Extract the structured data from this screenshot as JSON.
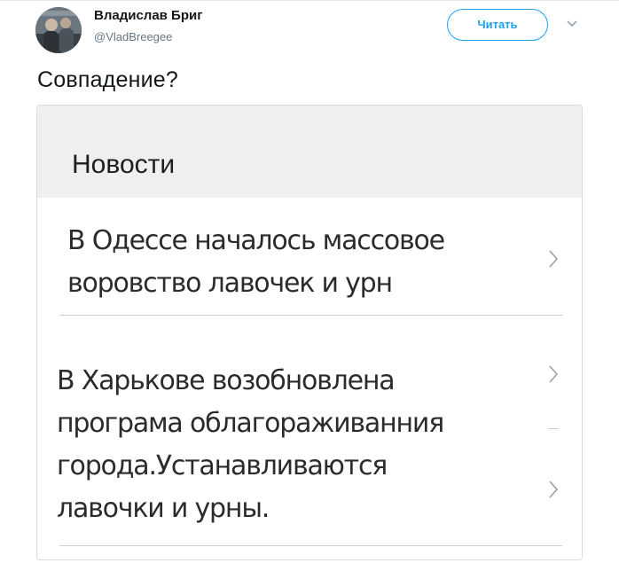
{
  "author": {
    "name": "Владислав Бриг",
    "handle": "@VladBreegee"
  },
  "follow_button": {
    "label": "Читать"
  },
  "tweet": {
    "text": "Совпадение?"
  },
  "screenshot": {
    "section_title": "Новости",
    "items": [
      {
        "lines": [
          "В Одессе началось массовое",
          "воровство лавочек и урн"
        ],
        "icon": "chevron-right-icon"
      },
      {
        "lines": [
          "В Харькове возобновлена",
          "програма облагораживанния",
          "города.Устанавливаются",
          "лавочки и урны."
        ],
        "icon": "chevron-right-icon"
      }
    ]
  },
  "colors": {
    "accent": "#1da1f2",
    "header_bg": "#efefef",
    "secondary_text": "#657786"
  }
}
